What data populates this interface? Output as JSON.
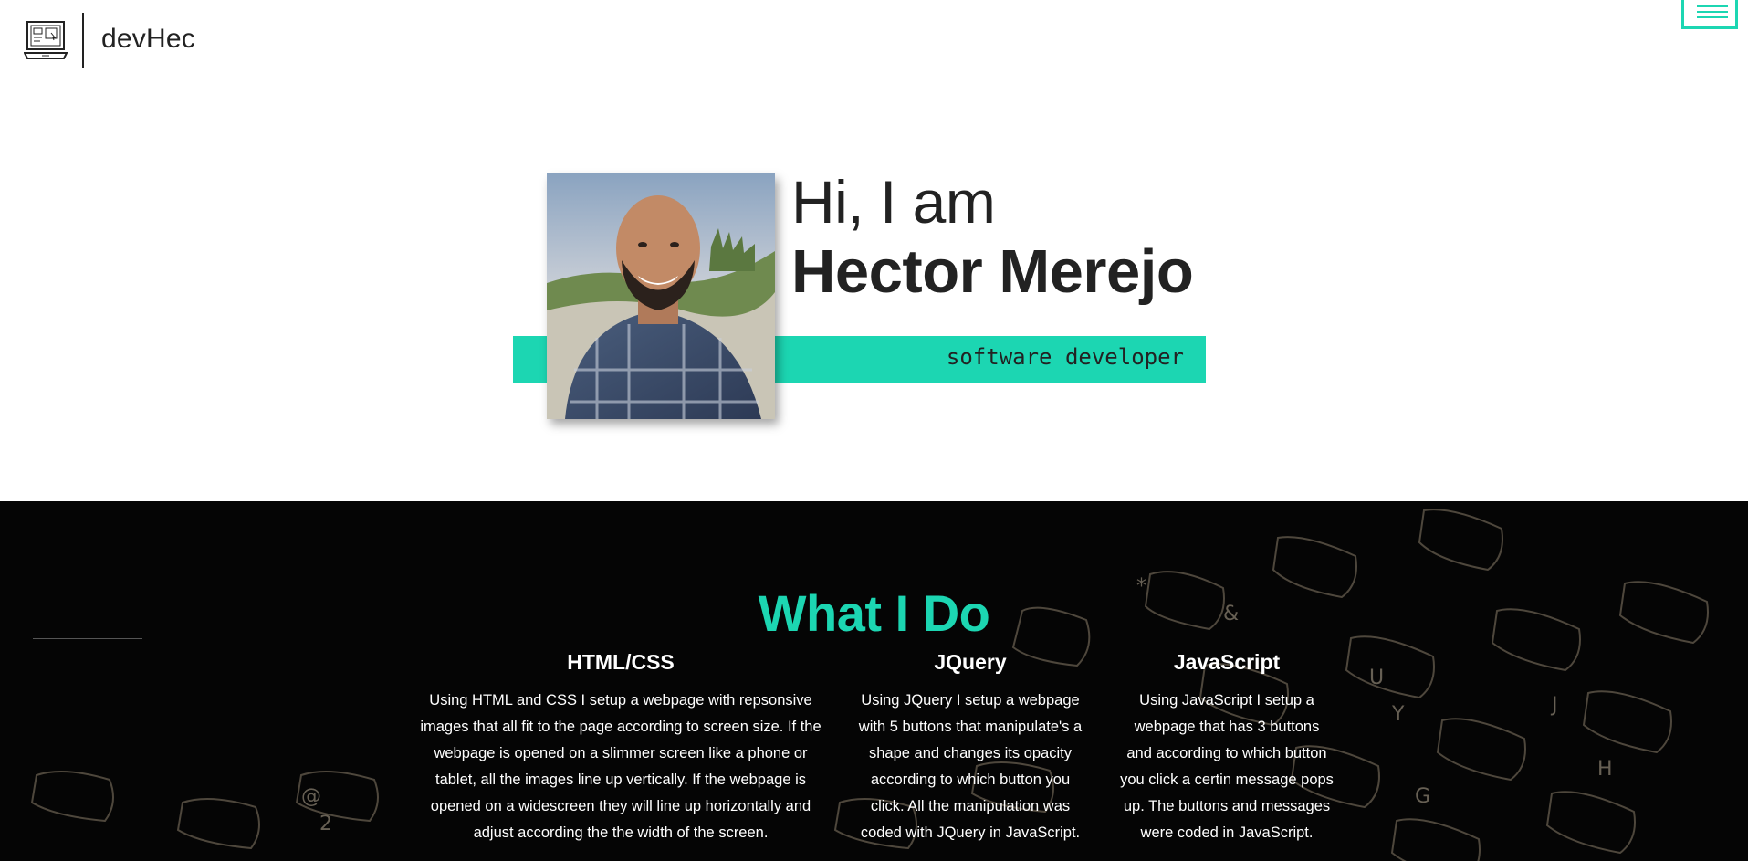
{
  "header": {
    "logo_icon": "laptop-icon",
    "brand": "devHec",
    "menu_icon": "hamburger-icon"
  },
  "hero": {
    "greeting": "Hi, I am",
    "name": "Hector Merejo",
    "role": "software developer",
    "photo_icon": "profile-photo"
  },
  "what_i_do": {
    "title": "What I Do",
    "items": [
      {
        "title": "HTML/CSS",
        "lines": [
          "Using HTML and CSS I setup a webpage with repsonsive",
          "images that all fit to the page according to screen size. If the",
          "webpage is opened on a slimmer screen like a phone or",
          "tablet, all the images line up vertically. If the webpage is",
          "opened on a widescreen they will line up horizontally and",
          "adjust according the the width of the screen."
        ]
      },
      {
        "title": "JQuery",
        "lines": [
          "Using JQuery I setup a webpage",
          "with 5 buttons that manipulate's a",
          "shape and changes its opacity",
          "according to which button you",
          "click. All the manipulation was",
          "coded with JQuery in JavaScript."
        ]
      },
      {
        "title": "JavaScript",
        "lines": [
          "Using JavaScript I setup a",
          "webpage that has 3 buttons",
          "and according to which button",
          "you click a certin message pops",
          "up. The buttons and messages",
          "were coded in JavaScript."
        ]
      }
    ]
  },
  "colors": {
    "accent": "#1cd6b2",
    "dark_bg": "#050505",
    "text": "#222222"
  }
}
